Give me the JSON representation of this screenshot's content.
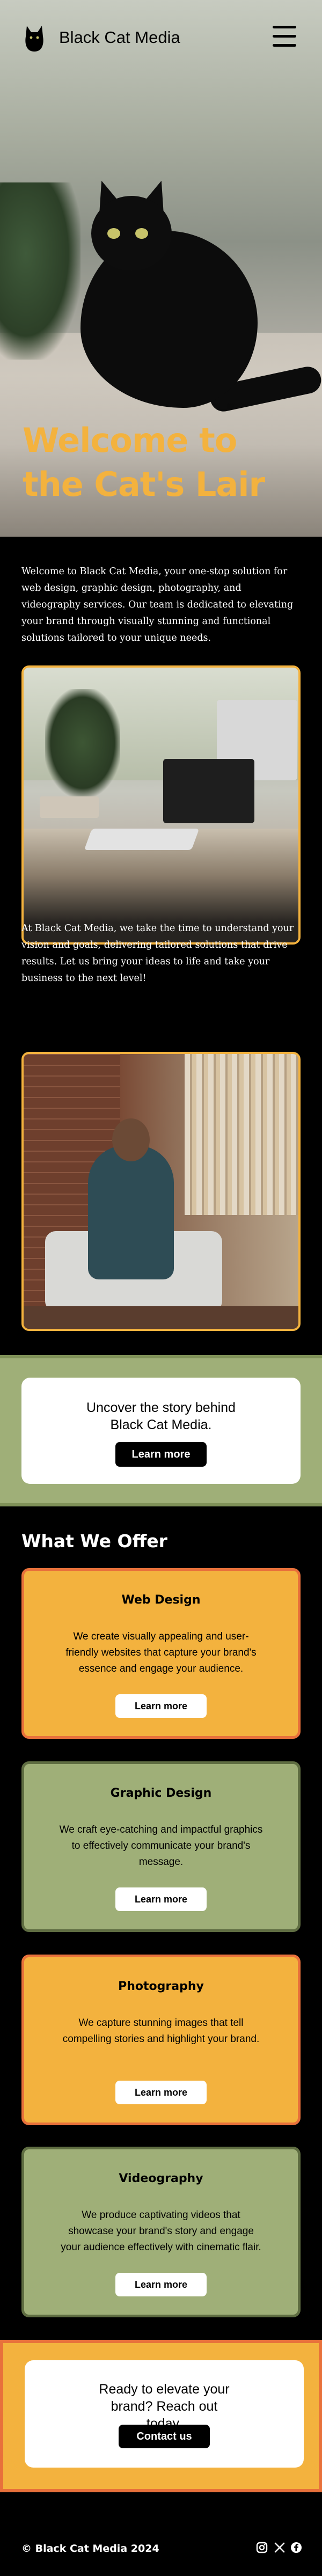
{
  "nav": {
    "brand": "Black Cat Media"
  },
  "hero": {
    "title": "Welcome to the Cat's Lair"
  },
  "intro": {
    "text": "Welcome to Black Cat Media, your one-stop solution for web design, graphic design, photography, and videography services. Our team is dedicated to elevating your brand through visually stunning and functional solutions tailored to your unique needs."
  },
  "mid": {
    "text": "At Black Cat Media, we take the time to understand your vision and goals, delivering tailored solutions that drive results. Let us bring your ideas to life and take your business to the next level!"
  },
  "story_cta": {
    "text": "Uncover the story behind Black Cat Media.",
    "button": "Learn more"
  },
  "offer": {
    "title": "What We Offer",
    "cards": [
      {
        "title": "Web Design",
        "text": "We create visually appealing and user-friendly websites that capture your brand's essence and engage your audience.",
        "button": "Learn more"
      },
      {
        "title": "Graphic Design",
        "text": "We craft eye-catching and impactful graphics to effectively communicate your brand's message.",
        "button": "Learn more"
      },
      {
        "title": "Photography",
        "text": "We capture stunning images that tell compelling stories and highlight your brand.",
        "button": "Learn more"
      },
      {
        "title": "Videography",
        "text": "We produce captivating videos that showcase your brand's story and engage your audience effectively with cinematic flair.",
        "button": "Learn more"
      }
    ]
  },
  "contact_cta": {
    "text": "Ready to elevate your brand? Reach out today.",
    "button": "Contact us"
  },
  "footer": {
    "copyright": "© Black Cat Media 2024",
    "social": [
      "instagram-icon",
      "x-icon",
      "facebook-icon"
    ]
  },
  "colors": {
    "accent_orange": "#f3b23e",
    "accent_red": "#e8713b",
    "accent_green": "#9faf78",
    "dark_green": "#5f6d42",
    "background": "#000000"
  }
}
